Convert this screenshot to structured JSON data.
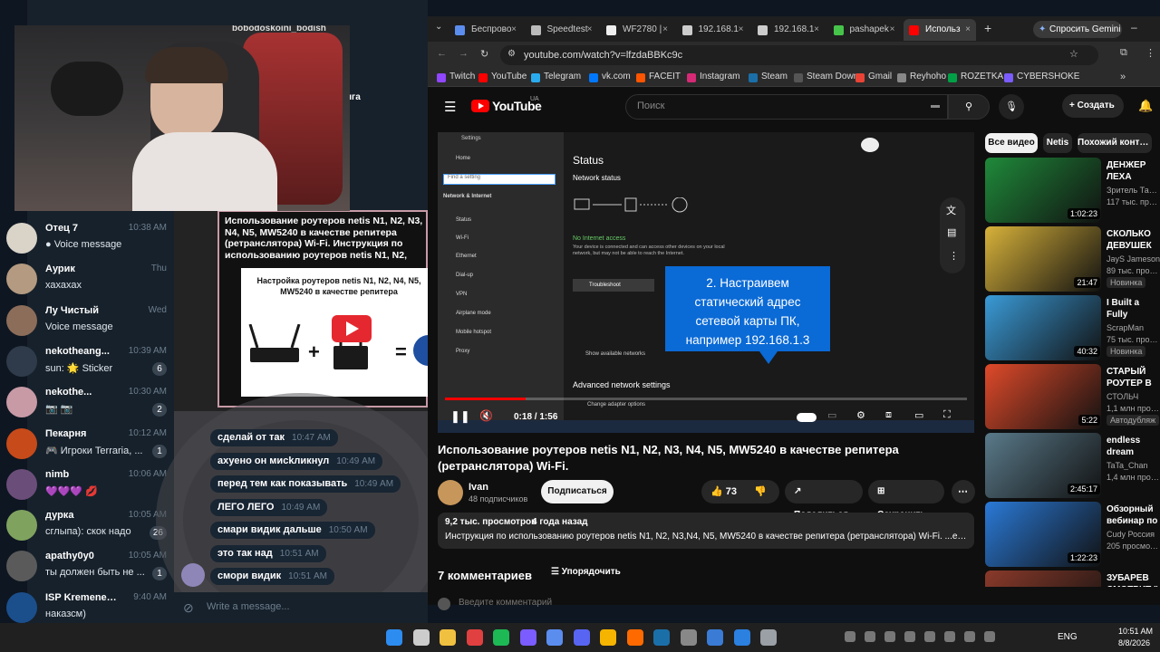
{
  "telegram": {
    "webcam_overlay_name": "bobodoskoini_bodish",
    "chats": [
      {
        "name": "Отец 7",
        "time": "10:38 AM",
        "preview": "● Voice message",
        "badge": "",
        "avatar_color": "#d9d3c8"
      },
      {
        "name": "Аурик",
        "time": "Thu",
        "preview": "хахахах",
        "badge": "",
        "avatar_color": "#b39a80"
      },
      {
        "name": "Лу Чистый",
        "time": "Wed",
        "preview": "Voice message",
        "badge": "",
        "avatar_color": "#8c6d5a"
      },
      {
        "name": "nekotheang...",
        "time": "10:39 AM",
        "preview": "sun: 🌟 Sticker",
        "badge": "6",
        "avatar_color": "#2f3b4a"
      },
      {
        "name": "nekothe...",
        "time": "10:30 AM",
        "preview": "📷 📷",
        "badge": "2",
        "avatar_color": "#c79aa6"
      },
      {
        "name": "Пекарня",
        "time": "10:12 AM",
        "preview": "🎮 Игроки Terraria, ...",
        "badge": "1",
        "avatar_color": "#c64a1a"
      },
      {
        "name": "nimb",
        "time": "10:06 AM",
        "preview": "💜💜💜 💋",
        "badge": "",
        "avatar_color": "#6b4d7a"
      },
      {
        "name": "дурка",
        "time": "10:05 AM",
        "preview": "сглыпа): скок надо",
        "badge": "26",
        "avatar_color": "#7fa35f"
      },
      {
        "name": "apathy0y0",
        "time": "10:05 AM",
        "preview": "ты должен быть не ...",
        "badge": "1",
        "avatar_color": "#5a5a5a"
      },
      {
        "name": "ISP Kremenets ...",
        "time": "9:40 AM",
        "preview": "наказсм)",
        "badge": "",
        "avatar_color": "#1b4f8c"
      }
    ],
    "pinned_post": {
      "text": "Использование роутеров netis N1, N2, N3, N4, N5, MW5240 в качестве репитера (ретранслятора) Wi-Fi. Инструкция по  использованию роутеров netis N1, N2, N3,N4, N5, MW5240 в качестве репитера",
      "image_caption": "Настройка роутеров netis N1, N2, N4, N5, MW5240 в качестве репитера",
      "sender_fragment": "нга"
    },
    "messages": [
      {
        "text": "сделай от так",
        "time": "10:47 AM"
      },
      {
        "text": "ахуено он мисkликнул",
        "time": "10:49 AM"
      },
      {
        "text": "перед тем как показывать",
        "time": "10:49 AM"
      },
      {
        "text": "ЛЕГО ЛЕГО",
        "time": "10:49 AM"
      },
      {
        "text": "смари видик дальше",
        "time": "10:50 AM"
      },
      {
        "text": "это так над",
        "time": "10:51 AM"
      },
      {
        "text": "смори видик",
        "time": "10:51 AM"
      }
    ],
    "compose_placeholder": "Write a message..."
  },
  "browser": {
    "tabs": [
      "Беспрово",
      "Speedtest",
      "WF2780 |",
      "192.168.1",
      "192.168.1",
      "pashapek",
      "Использ"
    ],
    "tab_colors": [
      "#5b8def",
      "#bbbbbb",
      "#eeeeee",
      "#cccccc",
      "#cccccc",
      "#46c44a",
      "#ff0000"
    ],
    "gemini_label": "Спросить Gemini",
    "url": "youtube.com/watch?v=lfzdaBBKc9c",
    "bookmarks": [
      {
        "label": "Twitch",
        "color": "#9146ff"
      },
      {
        "label": "YouTube",
        "color": "#ff0000"
      },
      {
        "label": "Telegram",
        "color": "#2aabee"
      },
      {
        "label": "vk.com",
        "color": "#0077ff"
      },
      {
        "label": "FACEIT",
        "color": "#ff5500"
      },
      {
        "label": "Instagram",
        "color": "#d62976"
      },
      {
        "label": "Steam",
        "color": "#1b6fa8"
      },
      {
        "label": "Steam Down",
        "color": "#555555"
      },
      {
        "label": "Gmail",
        "color": "#ea4335"
      },
      {
        "label": "Reyhoho",
        "color": "#888888"
      },
      {
        "label": "ROZETKA",
        "color": "#00a046"
      },
      {
        "label": "CYBERSHOKE",
        "color": "#7b5cff"
      }
    ]
  },
  "youtube": {
    "logo": "YouTube",
    "region": "UA",
    "search_placeholder": "Поиск",
    "create_label": "Создать",
    "player": {
      "settings_title": "Settings",
      "left_menu": [
        "Home",
        "Network & Internet",
        "Status",
        "Wi-Fi",
        "Ethernet",
        "Dial-up",
        "VPN",
        "Airplane mode",
        "Mobile hotspot",
        "Proxy"
      ],
      "find_setting": "Find a setting",
      "status_heading": "Status",
      "network_status": "Network status",
      "no_internet": "No Internet access",
      "device_text": "Your device is connected and can access other devices on your local network, but may not be able to reach the Internet.",
      "troubleshoot": "Troubleshoot",
      "show_networks": "Show available networks",
      "advanced": "Advanced network settings",
      "change_adapter": "Change adapter options",
      "overlay_text": "2. Настраивем статический адрес сетевой карты ПК, например 192.168.1.3",
      "time_current": "0:18",
      "time_total": "1:56",
      "progress": 0.155
    },
    "title": "Использование роутеров netis N1, N2, N3, N4, N5, MW5240 в качестве репитера (ретранслятора) Wi-Fi.",
    "channel": "Ivan",
    "subscribers": "48 подписчиков",
    "subscribe": "Подписаться",
    "likes": "73",
    "share": "Поделиться",
    "save": "Сохранить",
    "views": "9,2 тыс. просмотров",
    "age": "4 года назад",
    "description": "Инструкция по  использованию роутеров netis N1, N2, N3,N4, N5, MW5240 в качестве репитера (ретранслятора) Wi-Fi. ...ещё",
    "comments_count": "7 комментариев",
    "sort": "Упорядочить",
    "comment_placeholder": "Введите комментарий",
    "chips": [
      "Все видео",
      "Netis",
      "Похожий контент"
    ],
    "recommendations": [
      {
        "title": "ДЕНЖЕР ЛЕХА ПОВСТРЕЧАЛ",
        "channel": "Зритель Тавича",
        "views": "117 тыс. просмотров",
        "duration": "1:02:23",
        "badge": "",
        "color": "#1f8a3a"
      },
      {
        "title": "СКОЛЬКО ДЕВУШЕК БЫЛО",
        "channel": "JayS Jameson",
        "views": "89 тыс. просмотров",
        "duration": "21:47",
        "badge": "Новинка",
        "color": "#d8b23a"
      },
      {
        "title": "I Built a Fully Automatic Glow",
        "channel": "ScrapMan",
        "views": "75 тыс. просмотров",
        "duration": "40:32",
        "badge": "Новинка",
        "color": "#3a9bd8"
      },
      {
        "title": "СТАРЫЙ РОУТЕР В РОЛИ РЕПИТЕРА",
        "channel": "СТОЛЬЧ",
        "views": "1,1 млн просмотров",
        "duration": "5:22",
        "badge": "Автодубляж",
        "color": "#e04a2a"
      },
      {
        "title": "endless dream",
        "channel": "TaTa_Chan",
        "views": "1,4 млн просмотров",
        "duration": "2:45:17",
        "badge": "",
        "color": "#5a7a8a"
      },
      {
        "title": "Обзорный вебинар по ...",
        "channel": "Cudy Россия",
        "views": "205 просмотров",
        "duration": "1:22:23",
        "badge": "",
        "color": "#2a7ad8"
      },
      {
        "title": "ЗУБАРЕВ СМОТРИТ \" ...",
        "channel": "",
        "views": "",
        "duration": "",
        "badge": "",
        "color": "#8a3a2a"
      }
    ]
  },
  "taskbar": {
    "lang": "ENG",
    "time": "10:51 AM",
    "date": "8/8/2026"
  }
}
